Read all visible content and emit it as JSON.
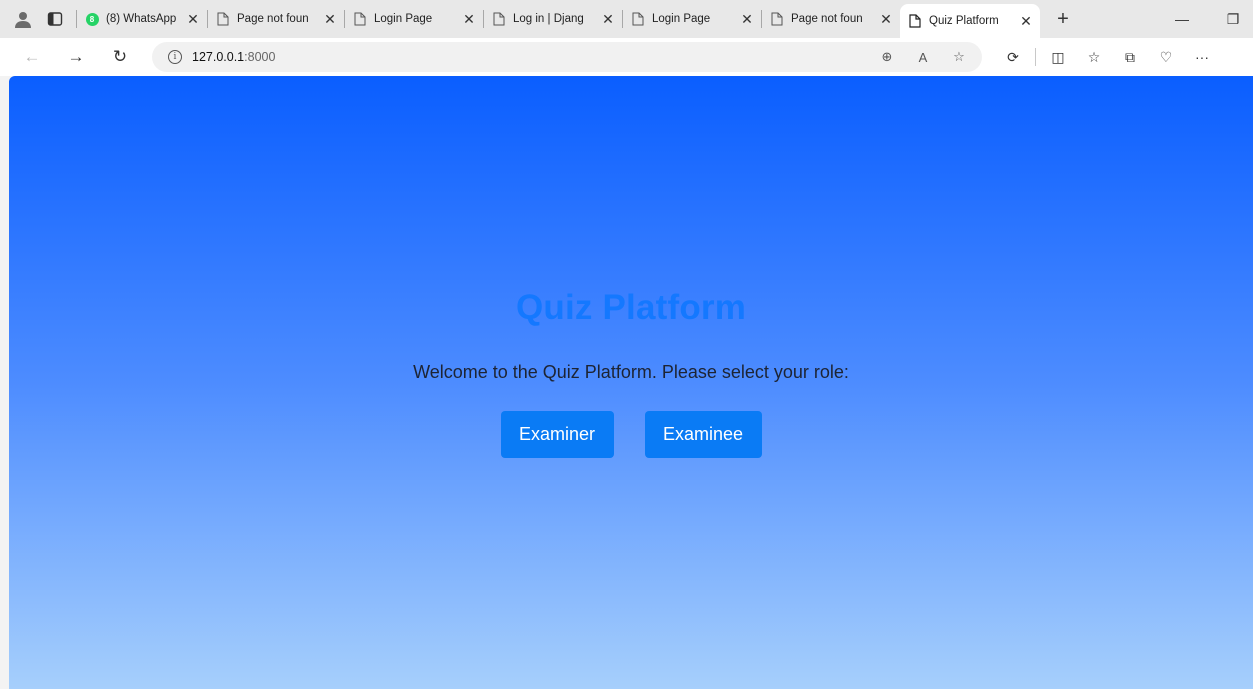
{
  "browser": {
    "tabs": [
      {
        "title": "(8) WhatsApp",
        "icon": "whatsapp-icon",
        "badge": "8",
        "active": false
      },
      {
        "title": "Page not foun",
        "icon": "page-icon",
        "active": false
      },
      {
        "title": "Login Page",
        "icon": "page-icon",
        "active": false
      },
      {
        "title": "Log in | Djang",
        "icon": "page-icon",
        "active": false
      },
      {
        "title": "Login Page",
        "icon": "page-icon",
        "active": false
      },
      {
        "title": "Page not foun",
        "icon": "page-icon",
        "active": false
      },
      {
        "title": "Quiz Platform",
        "icon": "page-icon",
        "active": true
      }
    ],
    "close_glyph": "✕",
    "new_tab_glyph": "+",
    "address": {
      "host": "127.0.0.1",
      "port": ":8000"
    },
    "window_controls": {
      "minimize": "—",
      "restore": "❐"
    }
  },
  "page": {
    "title": "Quiz Platform",
    "welcome_text": "Welcome to the Quiz Platform. Please select your role:",
    "buttons": {
      "examiner": "Examiner",
      "examinee": "Examinee"
    }
  },
  "colors": {
    "gradient_top": "#0a5eff",
    "gradient_bottom": "#a6cffc",
    "title_color": "#1478ff",
    "button_bg": "#0a7bf5"
  }
}
